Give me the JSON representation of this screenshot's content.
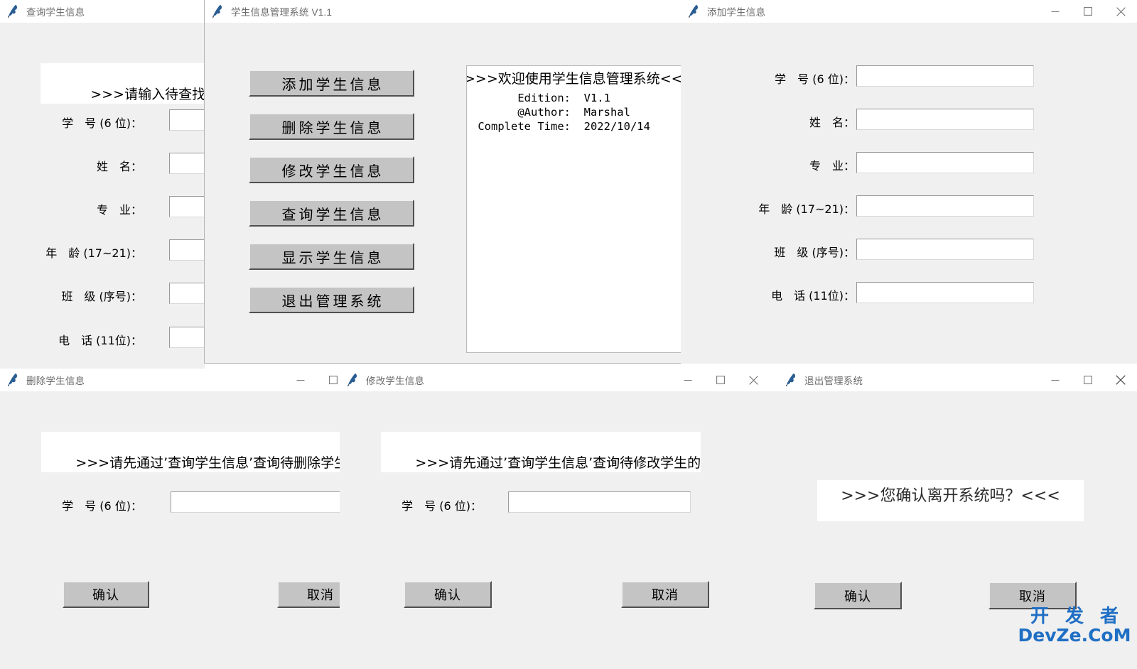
{
  "colors": {
    "window_bg": "#f0f0f0",
    "titlebar_bg": "#ffffff",
    "title_text": "#6b6b6b",
    "button_face": "#c4c4c4",
    "entry_bg": "#ffffff",
    "text_fg": "#000000",
    "watermark": "#1f6fc4"
  },
  "titlebar_controls": {
    "minimize": "minimize-icon",
    "maximize": "maximize-icon",
    "close": "close-icon",
    "app_icon": "python-feather-icon"
  },
  "windows": {
    "query": {
      "title": "查询学生信息",
      "message": ">>>请输入待查找学生的",
      "fields": [
        {
          "label": "学　号 (6 位)：",
          "value": ""
        },
        {
          "label": "姓　名：",
          "value": ""
        },
        {
          "label": "专　业：",
          "value": ""
        },
        {
          "label": "年　龄 (17~21)：",
          "value": ""
        },
        {
          "label": "班　级 (序号)：",
          "value": ""
        },
        {
          "label": "电　话 (11位)：",
          "value": ""
        }
      ]
    },
    "main": {
      "title": "学生信息管理系统 V1.1",
      "buttons": [
        {
          "label": "添加学生信息"
        },
        {
          "label": "删除学生信息"
        },
        {
          "label": "修改学生信息"
        },
        {
          "label": "查询学生信息"
        },
        {
          "label": "显示学生信息"
        },
        {
          "label": "退出管理系统"
        }
      ],
      "info_lines": [
        ">>>欢迎使用学生信息管理系统<<<",
        "       Edition:  V1.1",
        "       @Author:  Marshal",
        " Complete Time:  2022/10/14"
      ]
    },
    "add": {
      "title": "添加学生信息",
      "fields": [
        {
          "label": "学　号 (6 位)：",
          "value": ""
        },
        {
          "label": "姓　名：",
          "value": ""
        },
        {
          "label": "专　业：",
          "value": ""
        },
        {
          "label": "年　龄 (17~21)：",
          "value": ""
        },
        {
          "label": "班　级 (序号)：",
          "value": ""
        },
        {
          "label": "电　话 (11位)：",
          "value": ""
        }
      ]
    },
    "delete": {
      "title": "删除学生信息",
      "message": ">>>请先通过’查询学生信息’查询待删除学生的学号<<<",
      "field": {
        "label": "学　号 (6 位)：",
        "value": ""
      },
      "confirm_label": "确认",
      "cancel_label": "取消"
    },
    "modify": {
      "title": "修改学生信息",
      "message": ">>>请先通过’查询学生信息’查询待修改学生的学号<<<",
      "field": {
        "label": "学　号 (6 位)：",
        "value": ""
      },
      "confirm_label": "确认",
      "cancel_label": "取消"
    },
    "exit": {
      "title": "退出管理系统",
      "message": ">>>您确认离开系统吗？<<<",
      "confirm_label": "确认",
      "cancel_label": "取消"
    }
  },
  "watermark": {
    "line1": "开 发 者",
    "line2": "DevZe.CoM"
  }
}
